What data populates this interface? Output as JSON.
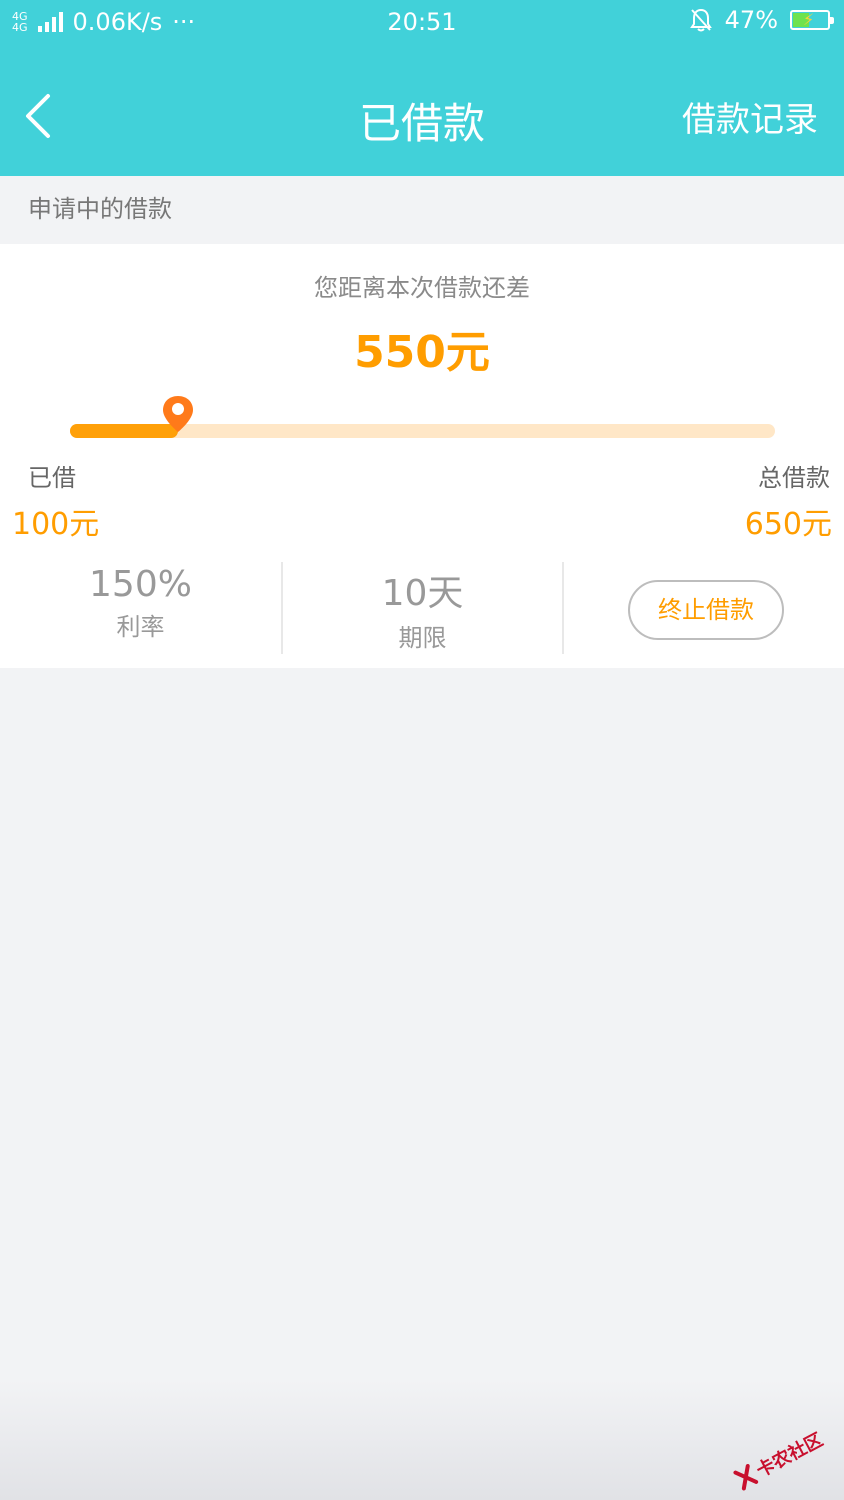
{
  "status_bar": {
    "network_badge_top": "4G",
    "network_badge_bottom": "4G",
    "speed": "0.06K/s",
    "more": "···",
    "time": "20:51",
    "battery_percent": "47%",
    "battery_level": 0.47
  },
  "nav": {
    "title": "已借款",
    "right_action": "借款记录"
  },
  "section_label": "申请中的借款",
  "loan": {
    "gap_text": "您距离本次借款还差",
    "gap_amount": "550元",
    "progress": 0.1538,
    "borrowed_label": "已借",
    "borrowed_value": "100元",
    "total_label": "总借款",
    "total_value": "650元"
  },
  "stats": {
    "rate_value": "150%",
    "rate_label": "利率",
    "term_value": "10天",
    "term_label": "期限",
    "stop_button": "终止借款"
  },
  "watermark": "卡农社区",
  "colors": {
    "header": "#41d1d9",
    "accent": "#ff9d00",
    "track": "#ffe7c7",
    "pin": "#ff7a1a"
  }
}
